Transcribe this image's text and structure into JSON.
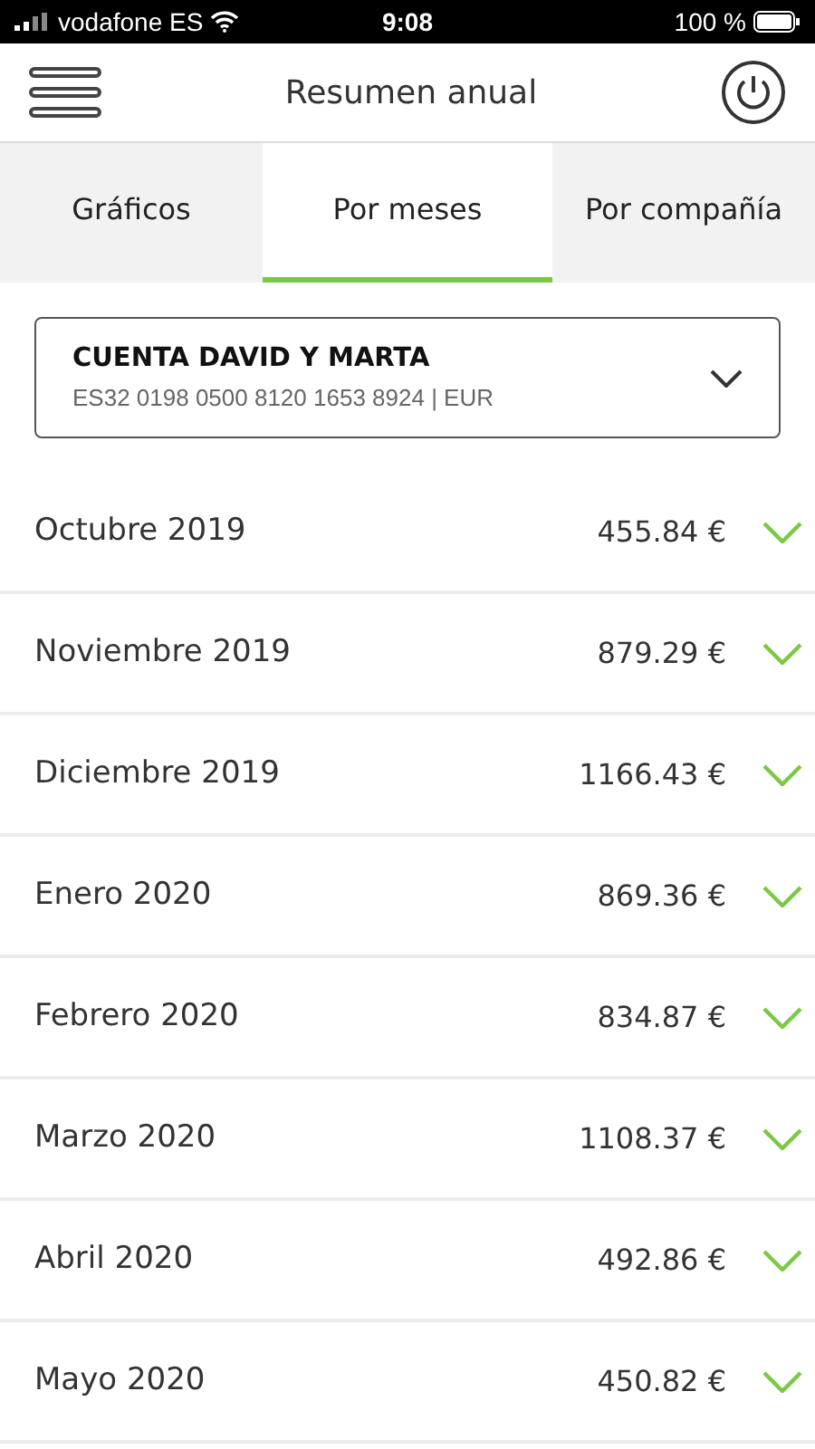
{
  "status_bar": {
    "carrier": "vodafone ES",
    "time": "9:08",
    "battery": "100 %"
  },
  "header": {
    "title": "Resumen anual"
  },
  "tabs": [
    {
      "label": "Gráficos",
      "selected": false
    },
    {
      "label": "Por meses",
      "selected": true
    },
    {
      "label": "Por compañía",
      "selected": false
    }
  ],
  "account": {
    "name": "CUENTA DAVID Y MARTA",
    "iban": "ES32 0198 0500 8120 1653 8924 | EUR"
  },
  "months": [
    {
      "label": "Octubre 2019",
      "amount": "455.84 €"
    },
    {
      "label": "Noviembre 2019",
      "amount": "879.29 €"
    },
    {
      "label": "Diciembre 2019",
      "amount": "1166.43 €"
    },
    {
      "label": "Enero 2020",
      "amount": "869.36 €"
    },
    {
      "label": "Febrero 2020",
      "amount": "834.87 €"
    },
    {
      "label": "Marzo 2020",
      "amount": "1108.37 €"
    },
    {
      "label": "Abril 2020",
      "amount": "492.86 €"
    },
    {
      "label": "Mayo 2020",
      "amount": "450.82 €"
    }
  ]
}
